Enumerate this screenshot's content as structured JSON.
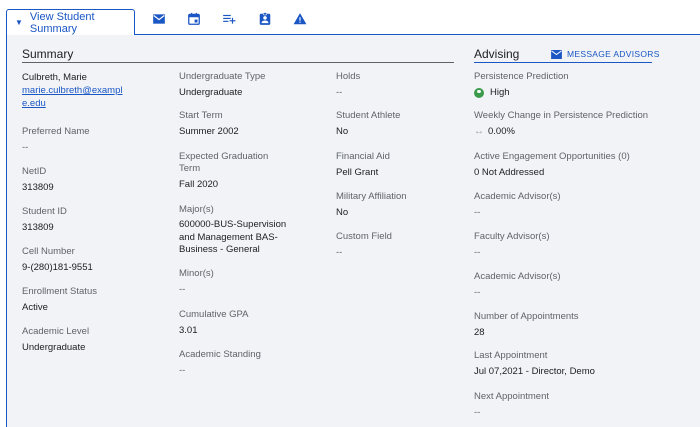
{
  "tabs": {
    "active_label": "View Student Summary",
    "icons": [
      "mail-icon",
      "calendar-icon",
      "playlist-add-icon",
      "assignment-ind-icon",
      "warning-icon"
    ]
  },
  "summary": {
    "title": "Summary",
    "col1": {
      "name": "Culbreth, Marie",
      "email_line1": "marie.culbreth@exampl",
      "email_line2": "e.edu",
      "preferred_name": {
        "label": "Preferred Name",
        "value": "--"
      },
      "netid": {
        "label": "NetID",
        "value": "313809"
      },
      "student_id": {
        "label": "Student ID",
        "value": "313809"
      },
      "cell": {
        "label": "Cell Number",
        "value": "9-(280)181-9551"
      },
      "enrollment": {
        "label": "Enrollment Status",
        "value": "Active"
      },
      "level": {
        "label": "Academic Level",
        "value": "Undergraduate"
      }
    },
    "col2": {
      "ug_type": {
        "label": "Undergraduate Type",
        "value": "Undergraduate"
      },
      "start_term": {
        "label": "Start Term",
        "value": "Summer 2002"
      },
      "grad_term": {
        "label_line1": "Expected Graduation",
        "label_line2": "Term",
        "value": "Fall 2020"
      },
      "majors": {
        "label": "Major(s)",
        "value_line1": "600000-BUS-Supervision",
        "value_line2": "and Management BAS-",
        "value_line3": "Business - General"
      },
      "minors": {
        "label": "Minor(s)",
        "value": "--"
      },
      "gpa": {
        "label": "Cumulative GPA",
        "value": "3.01"
      },
      "standing": {
        "label": "Academic Standing",
        "value": "--"
      }
    },
    "col3": {
      "holds": {
        "label": "Holds",
        "value": "--"
      },
      "athlete": {
        "label": "Student Athlete",
        "value": "No"
      },
      "aid": {
        "label": "Financial Aid",
        "value": "Pell Grant"
      },
      "military": {
        "label": "Military Affiliation",
        "value": "No"
      },
      "custom": {
        "label": "Custom Field",
        "value": "--"
      }
    }
  },
  "advising": {
    "title": "Advising",
    "message_button": "MESSAGE ADVISORS",
    "persistence": {
      "label": "Persistence Prediction",
      "value": "High"
    },
    "weekly_change": {
      "label": "Weekly Change in Persistence Prediction",
      "value": "0.00%"
    },
    "engagement": {
      "label": "Active Engagement Opportunities (0)",
      "value": "0 Not Addressed"
    },
    "academic_advisor_1": {
      "label": "Academic Advisor(s)",
      "value": "--"
    },
    "faculty_advisor": {
      "label": "Faculty Advisor(s)",
      "value": "--"
    },
    "academic_advisor_2": {
      "label": "Academic Advisor(s)",
      "value": "--"
    },
    "appointments": {
      "label": "Number of Appointments",
      "value": "28"
    },
    "last_appt": {
      "label": "Last Appointment",
      "value": "Jul 07,2021 - Director, Demo"
    },
    "next_appt": {
      "label": "Next Appointment",
      "value": "--"
    }
  },
  "colors": {
    "accent": "#1a56c4",
    "panel_bg": "#f1f3f6",
    "success": "#3c9a4b"
  }
}
